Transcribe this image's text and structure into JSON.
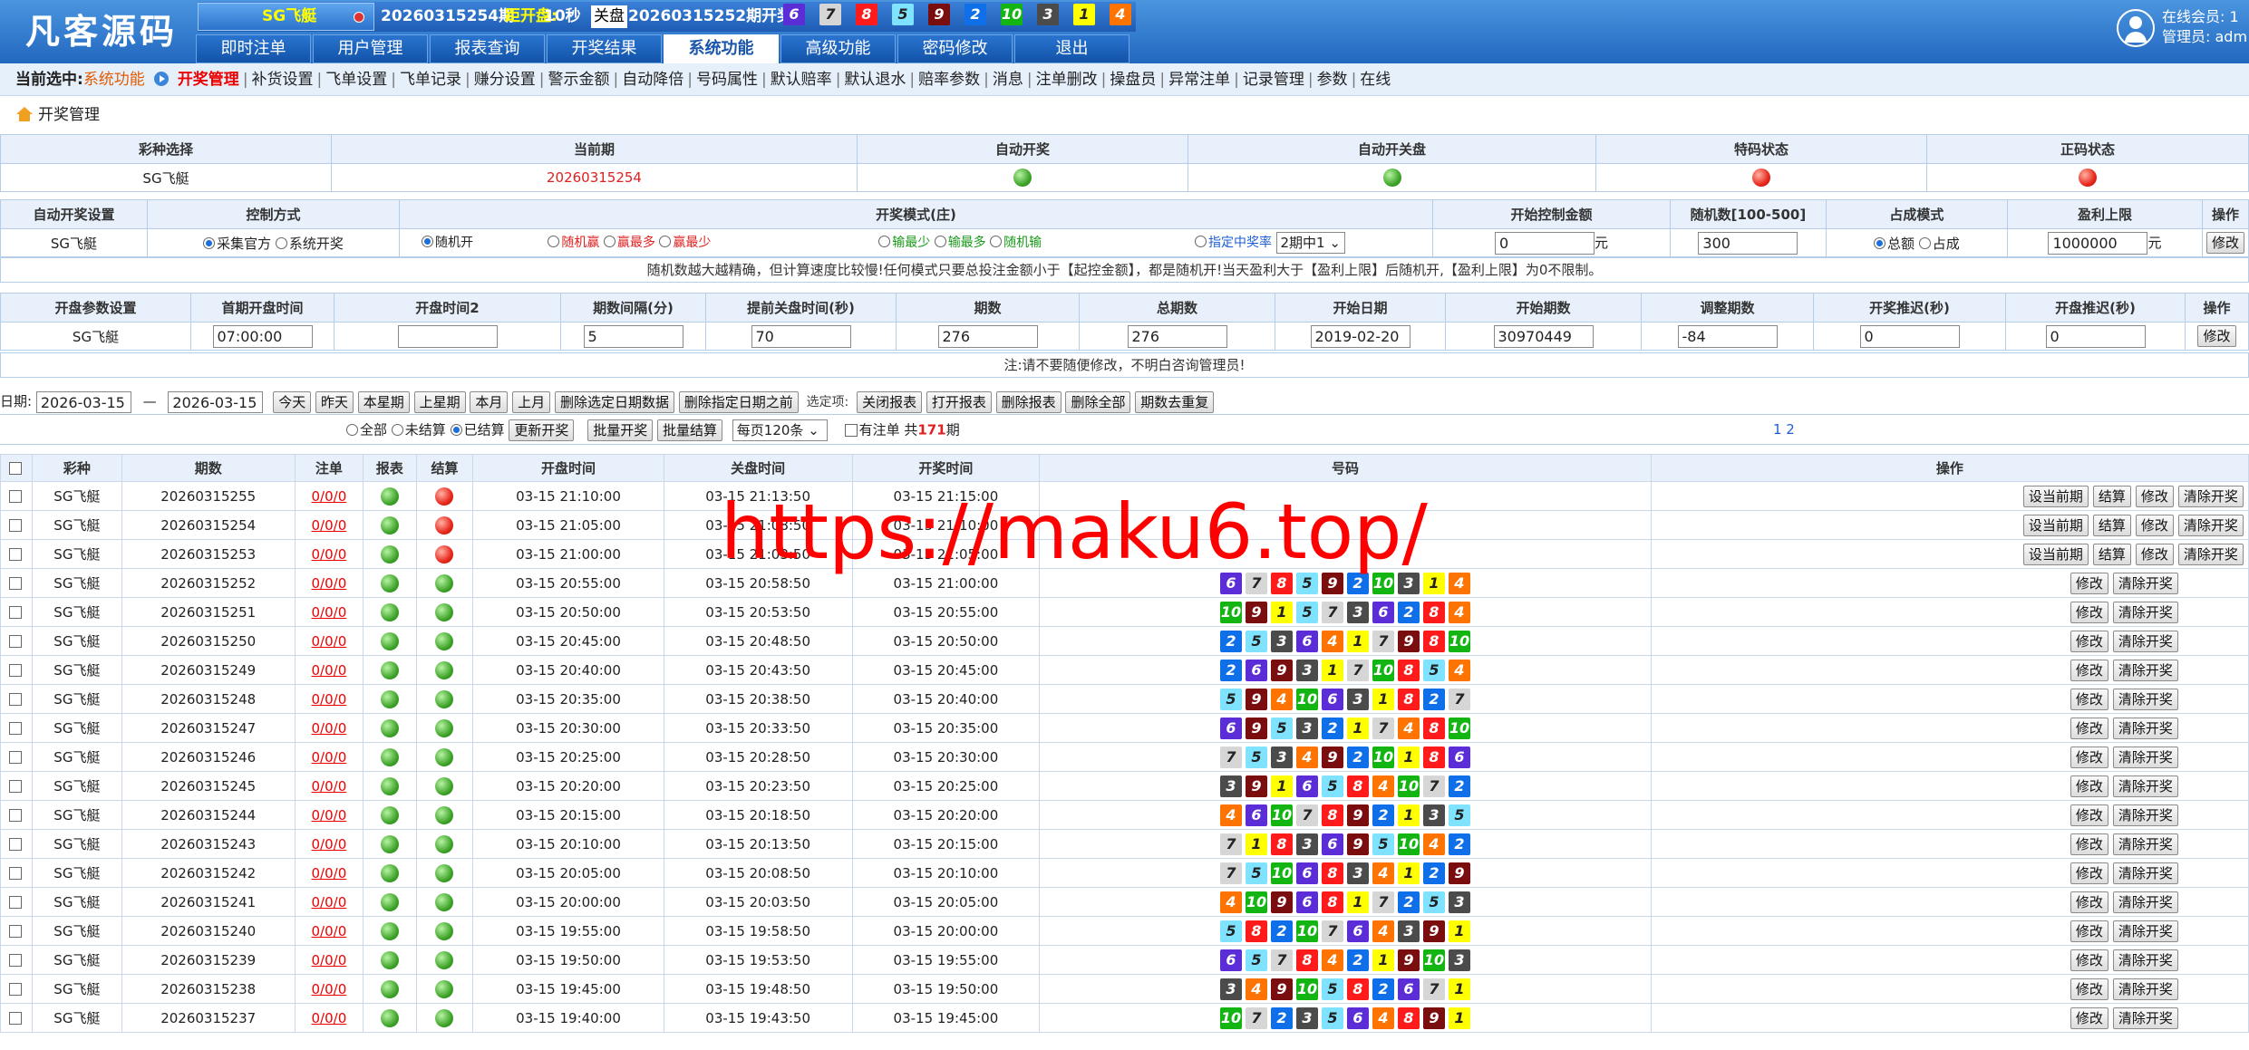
{
  "header": {
    "logo": "凡客源码",
    "lottery": "SG飞艇",
    "current_issue": "20260315254期",
    "countdown_label": "距开盘:",
    "countdown": "10秒",
    "closed_label": "关盘",
    "last_issue": "20260315252期开奖:",
    "last_numbers": [
      6,
      7,
      8,
      5,
      9,
      2,
      10,
      3,
      1,
      4
    ],
    "online_label": "在线会员:",
    "online_count": "1",
    "admin_label": "管理员:",
    "admin_name": "adm"
  },
  "tabs": [
    "即时注单",
    "用户管理",
    "报表查询",
    "开奖结果",
    "系统功能",
    "高级功能",
    "密码修改",
    "退出"
  ],
  "active_tab": "系统功能",
  "subnav": {
    "label": "当前选中:",
    "section": "系统功能",
    "current": "开奖管理",
    "items": [
      "补货设置",
      "飞单设置",
      "飞单记录",
      "赚分设置",
      "警示金额",
      "自动降倍",
      "号码属性",
      "默认赔率",
      "默认退水",
      "赔率参数",
      "消息",
      "注单删改",
      "操盘员",
      "异常注单",
      "记录管理",
      "参数",
      "在线"
    ]
  },
  "breadcrumb": "开奖管理",
  "status_table": {
    "headers": [
      "彩种选择",
      "当前期",
      "自动开奖",
      "自动开关盘",
      "特码状态",
      "正码状态"
    ],
    "lottery": "SG飞艇",
    "issue": "20260315254"
  },
  "auto_table": {
    "headers": [
      "自动开奖设置",
      "控制方式",
      "开奖模式(庄)",
      "开始控制金额",
      "随机数[100-500]",
      "占成模式",
      "盈利上限",
      "操作"
    ],
    "lottery": "SG飞艇",
    "control": [
      "采集官方",
      "系统开奖"
    ],
    "mode1": "随机开",
    "mode_red": [
      "随机赢",
      "赢最多",
      "赢最少"
    ],
    "mode_green": [
      "输最少",
      "输最多",
      "随机输"
    ],
    "mode_blue": "指定中奖率",
    "rate_select": "2期中1",
    "start_amount": "0",
    "yuan": "元",
    "random_num": "300",
    "share": [
      "总额",
      "占成"
    ],
    "profit_limit": "1000000",
    "edit": "修改",
    "note": "随机数越大越精确，但计算速度比较慢!任何模式只要总投注金额小于【起控金额】，都是随机开!当天盈利大于【盈利上限】后随机开,【盈利上限】为0不限制。"
  },
  "params_table": {
    "headers": [
      "开盘参数设置",
      "首期开盘时间",
      "开盘时间2",
      "期数间隔(分)",
      "提前关盘时间(秒)",
      "期数",
      "总期数",
      "开始日期",
      "开始期数",
      "调整期数",
      "开奖推迟(秒)",
      "开盘推迟(秒)",
      "操作"
    ],
    "lottery": "SG飞艇",
    "values": [
      "07:00:00",
      "",
      "5",
      "70",
      "276",
      "276",
      "2019-02-20",
      "30970449",
      "-84",
      "0",
      "0"
    ],
    "edit": "修改",
    "note": "注:请不要随便修改，不明白咨询管理员!"
  },
  "filter": {
    "date_label": "日期:",
    "date_from": "2026-03-15",
    "dash": "—",
    "date_to": "2026-03-15",
    "buttons": [
      "今天",
      "昨天",
      "本星期",
      "上星期",
      "本月",
      "上月",
      "删除选定日期数据",
      "删除指定日期之前"
    ],
    "options_label": "选定项:",
    "buttons2": [
      "关闭报表",
      "打开报表",
      "删除报表",
      "删除全部",
      "期数去重复"
    ],
    "radios": [
      "全部",
      "未结算",
      "已结算"
    ],
    "buttons3": [
      "更新开奖",
      "批量开奖",
      "批量结算"
    ],
    "page_size": "每页120条",
    "has_bets": "有注单",
    "total_prefix": "共",
    "total": "171",
    "total_suffix": "期",
    "pages": "1 2"
  },
  "list": {
    "headers": [
      "彩种",
      "期数",
      "注单",
      "报表",
      "结算",
      "开盘时间",
      "关盘时间",
      "开奖时间",
      "号码",
      "操作"
    ],
    "actions_pending": [
      "设当前期",
      "结算",
      "修改",
      "清除开奖"
    ],
    "actions_done": [
      "修改",
      "清除开奖"
    ],
    "rows": [
      {
        "lottery": "SG飞艇",
        "issue": "20260315255",
        "bets": "0/0/0",
        "settled": false,
        "open": "03-15 21:10:00",
        "close": "03-15 21:13:50",
        "draw": "03-15 21:15:00",
        "nums": []
      },
      {
        "lottery": "SG飞艇",
        "issue": "20260315254",
        "bets": "0/0/0",
        "settled": false,
        "open": "03-15 21:05:00",
        "close": "03-15 21:08:50",
        "draw": "03-15 21:10:00",
        "nums": []
      },
      {
        "lottery": "SG飞艇",
        "issue": "20260315253",
        "bets": "0/0/0",
        "settled": false,
        "open": "03-15 21:00:00",
        "close": "03-15 21:03:50",
        "draw": "03-15 21:05:00",
        "nums": []
      },
      {
        "lottery": "SG飞艇",
        "issue": "20260315252",
        "bets": "0/0/0",
        "settled": true,
        "open": "03-15 20:55:00",
        "close": "03-15 20:58:50",
        "draw": "03-15 21:00:00",
        "nums": [
          6,
          7,
          8,
          5,
          9,
          2,
          10,
          3,
          1,
          4
        ]
      },
      {
        "lottery": "SG飞艇",
        "issue": "20260315251",
        "bets": "0/0/0",
        "settled": true,
        "open": "03-15 20:50:00",
        "close": "03-15 20:53:50",
        "draw": "03-15 20:55:00",
        "nums": [
          10,
          9,
          1,
          5,
          7,
          3,
          6,
          2,
          8,
          4
        ]
      },
      {
        "lottery": "SG飞艇",
        "issue": "20260315250",
        "bets": "0/0/0",
        "settled": true,
        "open": "03-15 20:45:00",
        "close": "03-15 20:48:50",
        "draw": "03-15 20:50:00",
        "nums": [
          2,
          5,
          3,
          6,
          4,
          1,
          7,
          9,
          8,
          10
        ]
      },
      {
        "lottery": "SG飞艇",
        "issue": "20260315249",
        "bets": "0/0/0",
        "settled": true,
        "open": "03-15 20:40:00",
        "close": "03-15 20:43:50",
        "draw": "03-15 20:45:00",
        "nums": [
          2,
          6,
          9,
          3,
          1,
          7,
          10,
          8,
          5,
          4
        ]
      },
      {
        "lottery": "SG飞艇",
        "issue": "20260315248",
        "bets": "0/0/0",
        "settled": true,
        "open": "03-15 20:35:00",
        "close": "03-15 20:38:50",
        "draw": "03-15 20:40:00",
        "nums": [
          5,
          9,
          4,
          10,
          6,
          3,
          1,
          8,
          2,
          7
        ]
      },
      {
        "lottery": "SG飞艇",
        "issue": "20260315247",
        "bets": "0/0/0",
        "settled": true,
        "open": "03-15 20:30:00",
        "close": "03-15 20:33:50",
        "draw": "03-15 20:35:00",
        "nums": [
          6,
          9,
          5,
          3,
          2,
          1,
          7,
          4,
          8,
          10
        ]
      },
      {
        "lottery": "SG飞艇",
        "issue": "20260315246",
        "bets": "0/0/0",
        "settled": true,
        "open": "03-15 20:25:00",
        "close": "03-15 20:28:50",
        "draw": "03-15 20:30:00",
        "nums": [
          7,
          5,
          3,
          4,
          9,
          2,
          10,
          1,
          8,
          6
        ]
      },
      {
        "lottery": "SG飞艇",
        "issue": "20260315245",
        "bets": "0/0/0",
        "settled": true,
        "open": "03-15 20:20:00",
        "close": "03-15 20:23:50",
        "draw": "03-15 20:25:00",
        "nums": [
          3,
          9,
          1,
          6,
          5,
          8,
          4,
          10,
          7,
          2
        ]
      },
      {
        "lottery": "SG飞艇",
        "issue": "20260315244",
        "bets": "0/0/0",
        "settled": true,
        "open": "03-15 20:15:00",
        "close": "03-15 20:18:50",
        "draw": "03-15 20:20:00",
        "nums": [
          4,
          6,
          10,
          7,
          8,
          9,
          2,
          1,
          3,
          5
        ]
      },
      {
        "lottery": "SG飞艇",
        "issue": "20260315243",
        "bets": "0/0/0",
        "settled": true,
        "open": "03-15 20:10:00",
        "close": "03-15 20:13:50",
        "draw": "03-15 20:15:00",
        "nums": [
          7,
          1,
          8,
          3,
          6,
          9,
          5,
          10,
          4,
          2
        ]
      },
      {
        "lottery": "SG飞艇",
        "issue": "20260315242",
        "bets": "0/0/0",
        "settled": true,
        "open": "03-15 20:05:00",
        "close": "03-15 20:08:50",
        "draw": "03-15 20:10:00",
        "nums": [
          7,
          5,
          10,
          6,
          8,
          3,
          4,
          1,
          2,
          9
        ]
      },
      {
        "lottery": "SG飞艇",
        "issue": "20260315241",
        "bets": "0/0/0",
        "settled": true,
        "open": "03-15 20:00:00",
        "close": "03-15 20:03:50",
        "draw": "03-15 20:05:00",
        "nums": [
          4,
          10,
          9,
          6,
          8,
          1,
          7,
          2,
          5,
          3
        ]
      },
      {
        "lottery": "SG飞艇",
        "issue": "20260315240",
        "bets": "0/0/0",
        "settled": true,
        "open": "03-15 19:55:00",
        "close": "03-15 19:58:50",
        "draw": "03-15 20:00:00",
        "nums": [
          5,
          8,
          2,
          10,
          7,
          6,
          4,
          3,
          9,
          1
        ]
      },
      {
        "lottery": "SG飞艇",
        "issue": "20260315239",
        "bets": "0/0/0",
        "settled": true,
        "open": "03-15 19:50:00",
        "close": "03-15 19:53:50",
        "draw": "03-15 19:55:00",
        "nums": [
          6,
          5,
          7,
          8,
          4,
          2,
          1,
          9,
          10,
          3
        ]
      },
      {
        "lottery": "SG飞艇",
        "issue": "20260315238",
        "bets": "0/0/0",
        "settled": true,
        "open": "03-15 19:45:00",
        "close": "03-15 19:48:50",
        "draw": "03-15 19:50:00",
        "nums": [
          3,
          4,
          9,
          10,
          5,
          8,
          2,
          6,
          7,
          1
        ]
      },
      {
        "lottery": "SG飞艇",
        "issue": "20260315237",
        "bets": "0/0/0",
        "settled": true,
        "open": "03-15 19:40:00",
        "close": "03-15 19:43:50",
        "draw": "03-15 19:45:00",
        "nums": [
          10,
          7,
          2,
          3,
          5,
          6,
          4,
          8,
          9,
          1
        ]
      }
    ]
  },
  "ball_colors": {
    "1": "#ffff00",
    "2": "#0e6fe8",
    "3": "#4b4b4b",
    "4": "#ff7300",
    "5": "#7fe3ff",
    "6": "#5a2dd6",
    "7": "#d6d6d6",
    "8": "#ff1b1b",
    "9": "#7a0e0e",
    "10": "#13b513"
  },
  "watermark": "https://maku6.top/"
}
